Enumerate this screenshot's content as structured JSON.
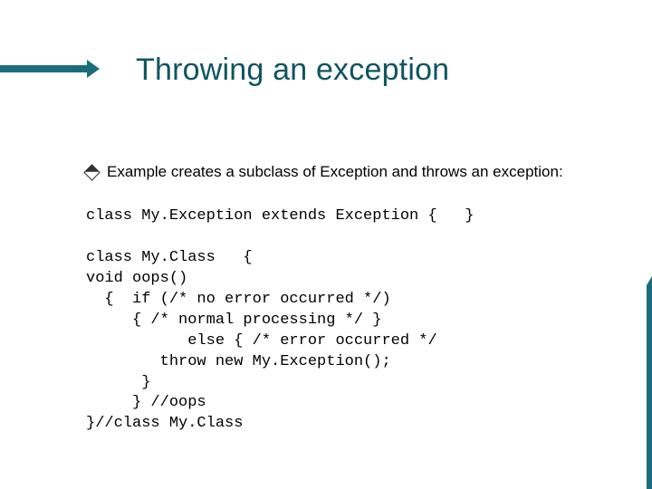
{
  "title": "Throwing an exception",
  "bullet": "Example creates a subclass of Exception and throws an exception:",
  "code_lines": {
    "l1": "class My.Exception extends Exception {   }",
    "l2": "",
    "l3": "class My.Class   {",
    "l4": "void oops()",
    "l5": "  {  if (/* no error occurred */)",
    "l6": "     { /* normal processing */ }",
    "l7": "           else { /* error occurred */",
    "l8": "        throw new My.Exception();",
    "l9": "      }",
    "l10": "     } //oops",
    "l11": "}//class My.Class"
  }
}
